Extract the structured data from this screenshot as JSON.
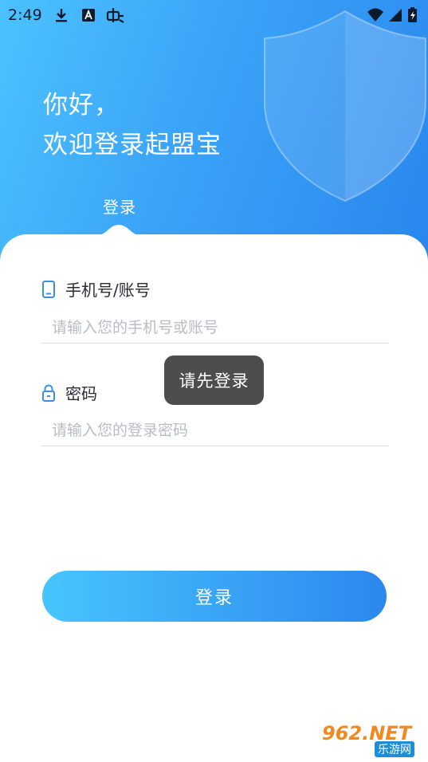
{
  "status_bar": {
    "time": "2:49",
    "icons": [
      "download-icon",
      "notification-a-icon",
      "bug-icon",
      "wifi-icon",
      "signal-icon",
      "battery-charging-icon"
    ]
  },
  "hero": {
    "greeting_line1": "你好，",
    "greeting_line2": "欢迎登录起盟宝",
    "tab_label": "登录"
  },
  "form": {
    "account_label": "手机号/账号",
    "account_placeholder": "请输入您的手机号或账号",
    "password_label": "密码",
    "password_placeholder": "请输入您的登录密码",
    "submit_label": "登录"
  },
  "toast": {
    "message": "请先登录"
  },
  "watermark": {
    "main": "962.NET",
    "sub": "乐游网"
  },
  "colors": {
    "gradient_start": "#4cc2ff",
    "gradient_end": "#2a86ee",
    "accent_icon": "#3a8ee8",
    "toast_bg": "#4d4d4d"
  }
}
